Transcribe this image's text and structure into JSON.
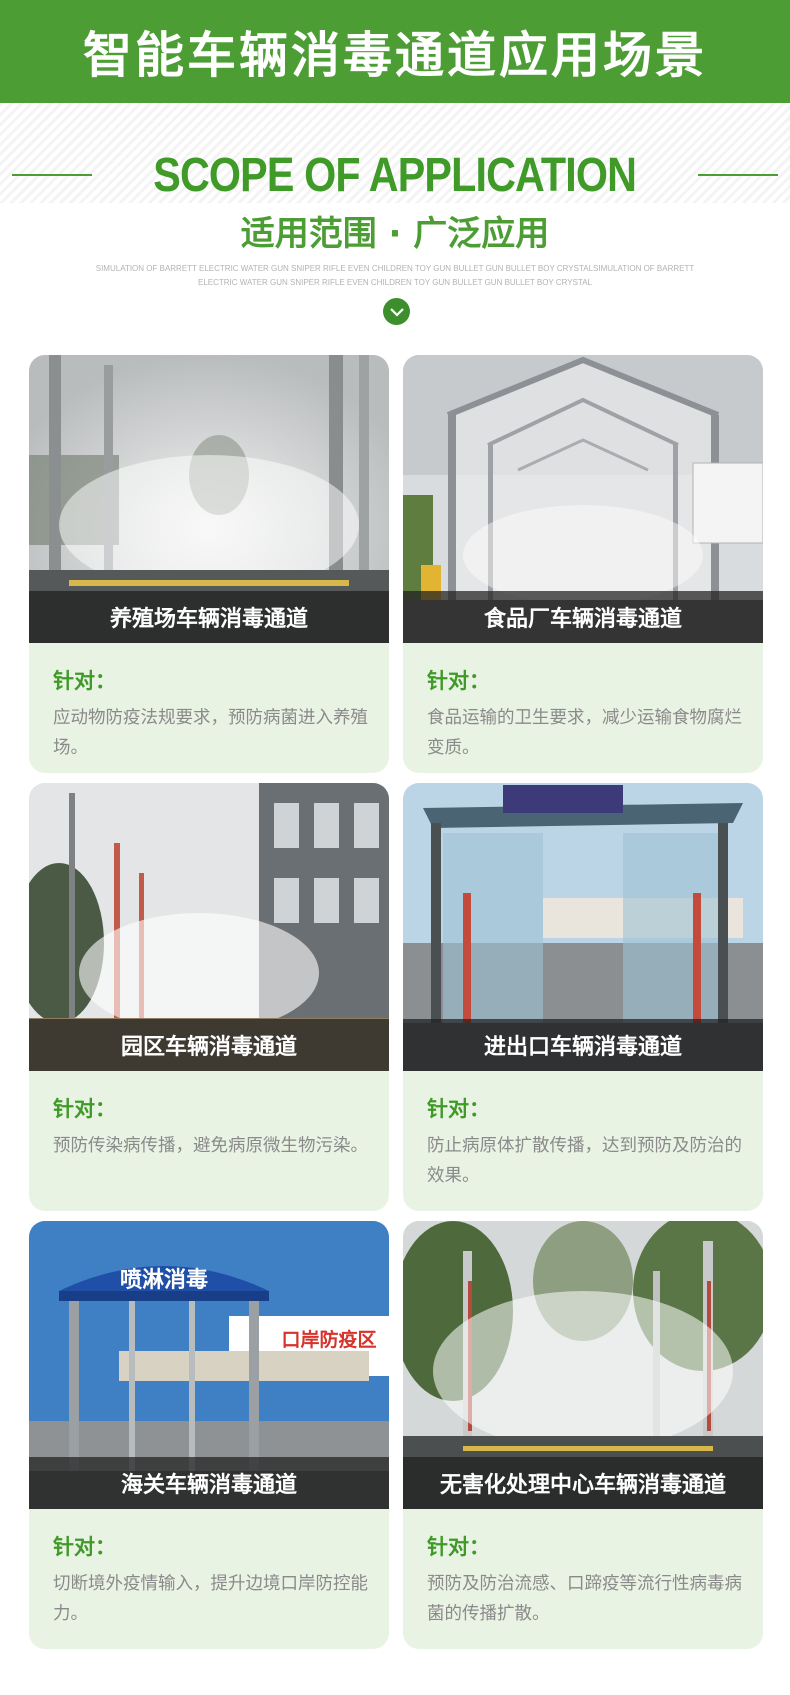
{
  "header": {
    "title": "智能车辆消毒通道应用场景",
    "scope_en": "SCOPE OF APPLICATION",
    "scope_cn": "适用范围 · 广泛应用",
    "fine_print": "SIMULATION OF BARRETT ELECTRIC WATER GUN SNIPER RIFLE EVEN CHILDREN TOY GUN BULLET GUN BULLET BOY CRYSTALSIMULATION OF BARRETT ELECTRIC WATER GUN SNIPER RIFLE EVEN CHILDREN TOY GUN BULLET GUN BULLET BOY CRYSTAL"
  },
  "colors": {
    "brand_green": "#4d9d35",
    "card_bg": "#e9f3e4",
    "text_gray": "#8a8a8a"
  },
  "icons": {
    "scroll_down": "chevron-down-icon"
  },
  "cards": [
    {
      "caption": "养殖场车辆消毒通道",
      "label": "针对：",
      "desc": "应动物防疫法规要求，预防病菌进入养殖场。"
    },
    {
      "caption": "食品厂车辆消毒通道",
      "label": "针对：",
      "desc": "食品运输的卫生要求，减少运输食物腐烂变质。"
    },
    {
      "caption": "园区车辆消毒通道",
      "label": "针对：",
      "desc": "预防传染病传播，避免病原微生物污染。"
    },
    {
      "caption": "进出口车辆消毒通道",
      "label": "针对：",
      "desc": "防止病原体扩散传播，达到预防及防治的效果。"
    },
    {
      "caption": "海关车辆消毒通道",
      "label": "针对：",
      "desc": "切断境外疫情输入，提升边境口岸防控能力。"
    },
    {
      "caption": "无害化处理中心车辆消毒通道",
      "label": "针对：",
      "desc": "预防及防治流感、口蹄疫等流行性病毒病菌的传播扩散。"
    }
  ],
  "photo_signs": {
    "customs_roof": "喷淋消毒",
    "customs_sign": "口岸防疫区"
  }
}
